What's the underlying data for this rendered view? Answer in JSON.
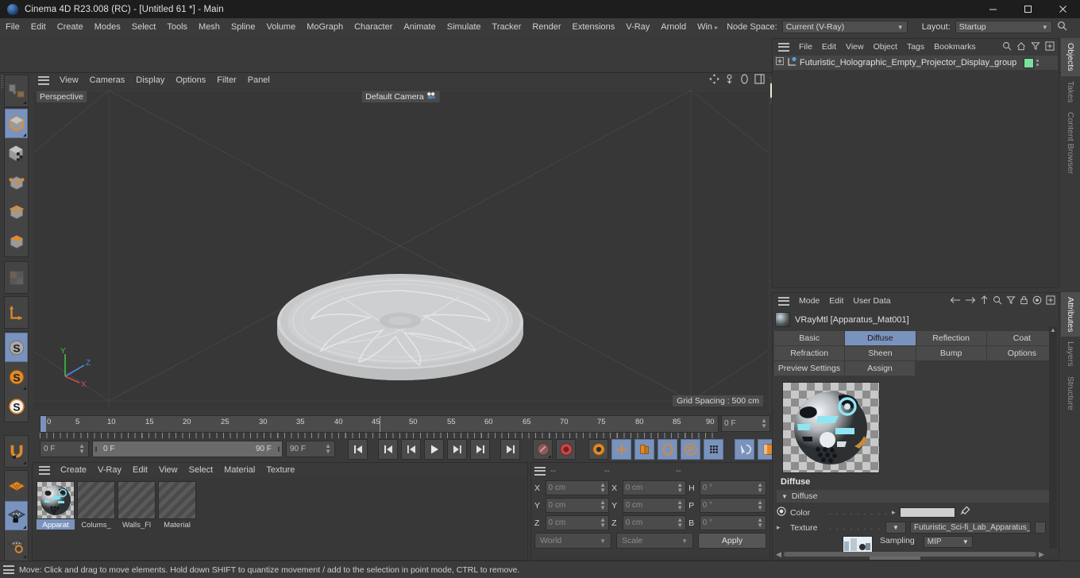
{
  "titlebar": {
    "title": "Cinema 4D R23.008 (RC) - [Untitled 61 *] - Main",
    "minimize": "─",
    "maximize": "☐",
    "close": "✕"
  },
  "menubar": {
    "items": [
      "File",
      "Edit",
      "Create",
      "Modes",
      "Select",
      "Tools",
      "Mesh",
      "Spline",
      "Volume",
      "MoGraph",
      "Character",
      "Animate",
      "Simulate",
      "Tracker",
      "Render",
      "Extensions",
      "V-Ray",
      "Arnold",
      "Wind"
    ],
    "node_space_label": "Node Space:",
    "node_space_value": "Current (V-Ray)",
    "layout_label": "Layout:",
    "layout_value": "Startup"
  },
  "viewport": {
    "menu": [
      "View",
      "Cameras",
      "Display",
      "Options",
      "Filter",
      "Panel"
    ],
    "label": "Perspective",
    "camera": "Default Camera",
    "grid_spacing": "Grid Spacing : 500 cm",
    "axis": {
      "x": "X",
      "y": "Y",
      "z": "Z"
    }
  },
  "timeline": {
    "ticks": [
      "0",
      "5",
      "10",
      "15",
      "20",
      "25",
      "30",
      "35",
      "40",
      "45",
      "50",
      "55",
      "60",
      "65",
      "70",
      "75",
      "80",
      "85",
      "90"
    ],
    "current_frame_right": "0 F",
    "start_field": "0 F",
    "range_start": "0 F",
    "range_end": "90 F",
    "end_field": "90 F"
  },
  "material_manager": {
    "menu": [
      "Create",
      "V-Ray",
      "Edit",
      "View",
      "Select",
      "Material",
      "Texture"
    ],
    "materials": [
      {
        "name": "Apparat",
        "selected": true
      },
      {
        "name": "Colums_",
        "selected": false
      },
      {
        "name": "Walls_Fl",
        "selected": false
      },
      {
        "name": "Material",
        "selected": false
      }
    ]
  },
  "coordinates": {
    "headers": [
      "--",
      "--",
      "--"
    ],
    "rows": [
      {
        "l1": "X",
        "v1": "0 cm",
        "l2": "X",
        "v2": "0 cm",
        "l3": "H",
        "v3": "0 °"
      },
      {
        "l1": "Y",
        "v1": "0 cm",
        "l2": "Y",
        "v2": "0 cm",
        "l3": "P",
        "v3": "0 °"
      },
      {
        "l1": "Z",
        "v1": "0 cm",
        "l2": "Z",
        "v2": "0 cm",
        "l3": "B",
        "v3": "0 °"
      }
    ],
    "system": "World",
    "mode": "Scale",
    "apply": "Apply"
  },
  "status": {
    "text": "Move: Click and drag to move elements. Hold down SHIFT to quantize movement / add to the selection in point mode, CTRL to remove."
  },
  "object_manager": {
    "menu": [
      "File",
      "Edit",
      "View",
      "Object",
      "Tags",
      "Bookmarks"
    ],
    "object_name": "Futuristic_Holographic_Empty_Projector_Display_group",
    "object_tag_color": "#7ce0a0"
  },
  "attributes": {
    "menu": [
      "Mode",
      "Edit",
      "User Data"
    ],
    "title": "VRayMtl [Apparatus_Mat001]",
    "tabs_row1": [
      {
        "label": "Basic",
        "active": false
      },
      {
        "label": "Diffuse",
        "active": true
      },
      {
        "label": "Reflection",
        "active": false
      },
      {
        "label": "Coat",
        "active": false
      }
    ],
    "tabs_row2": [
      {
        "label": "Refraction",
        "active": false
      },
      {
        "label": "Sheen",
        "active": false
      },
      {
        "label": "Bump",
        "active": false
      },
      {
        "label": "Options",
        "active": false
      }
    ],
    "tabs_row3": [
      {
        "label": "Preview Settings",
        "active": false
      },
      {
        "label": "Assign",
        "active": false
      }
    ],
    "section_title": "Diffuse",
    "group_header": "Diffuse",
    "color_label": "Color",
    "texture_label": "Texture",
    "texture_value": "Futuristic_Sci-fi_Lab_Apparatus_B",
    "sampling_label": "Sampling",
    "sampling_value": "MIP",
    "color_swatch": "#cfcfcf",
    "dots": ". . . . . . . . . ."
  },
  "dock_tabs": {
    "top": [
      {
        "label": "Objects",
        "active": true
      },
      {
        "label": "Takes",
        "active": false
      },
      {
        "label": "Content Browser",
        "active": false
      }
    ],
    "bottom": [
      {
        "label": "Attributes",
        "active": true
      },
      {
        "label": "Layers",
        "active": false
      },
      {
        "label": "Structure",
        "active": false
      }
    ]
  },
  "colors": {
    "accent": "#7a93bd",
    "panel": "#3a3a3a",
    "panel_dark": "#383838",
    "orange": "#e08a2a"
  }
}
